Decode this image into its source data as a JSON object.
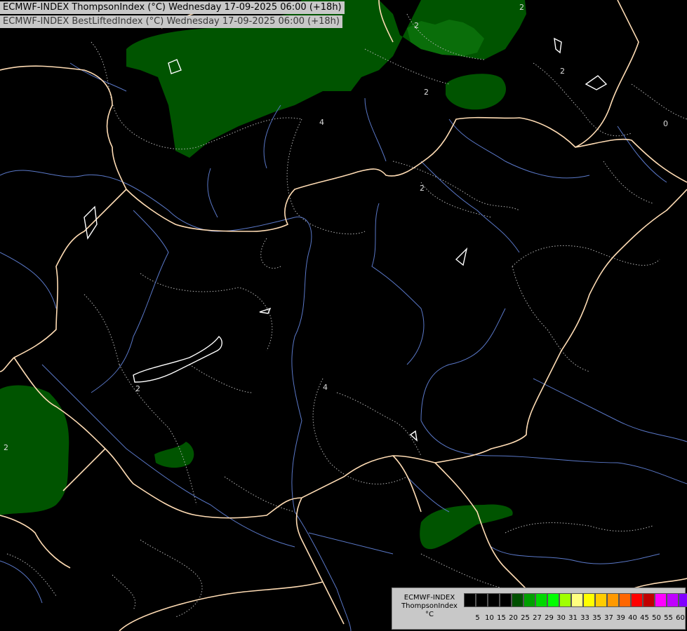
{
  "header": {
    "line1": "ECMWF-INDEX ThompsonIndex (°C) Wednesday 17-09-2025 06:00 (+18h)",
    "line2": "ECMWF-INDEX BestLiftedIndex (°C) Wednesday 17-09-2025 06:00 (+18h)"
  },
  "legend": {
    "title_line1": "ECMWF-INDEX",
    "title_line2": "ThompsonIndex",
    "title_line3": "°C",
    "colors": [
      "#000000",
      "#000000",
      "#000000",
      "#000000",
      "#005000",
      "#00a000",
      "#00d800",
      "#00ff00",
      "#a0ff00",
      "#ffff80",
      "#ffff00",
      "#ffcc00",
      "#ff9900",
      "#ff6600",
      "#ff0000",
      "#c00000",
      "#ff00ff",
      "#c000ff",
      "#8000ff",
      "#4000ff",
      "#0000ff"
    ],
    "ticks": [
      "5",
      "10",
      "15",
      "20",
      "25",
      "27",
      "29",
      "30",
      "31",
      "33",
      "35",
      "37",
      "39",
      "40",
      "45",
      "50",
      "55",
      "60"
    ]
  },
  "contour_labels": [
    "2",
    "2",
    "2",
    "2",
    "4",
    "2",
    "0",
    "2",
    "4",
    "2"
  ],
  "colors": {
    "green_area": "#005400",
    "border": "#ffdcb4",
    "river": "#5a78c8",
    "contour": "#b4b4b4",
    "lake": "#ffffff"
  }
}
